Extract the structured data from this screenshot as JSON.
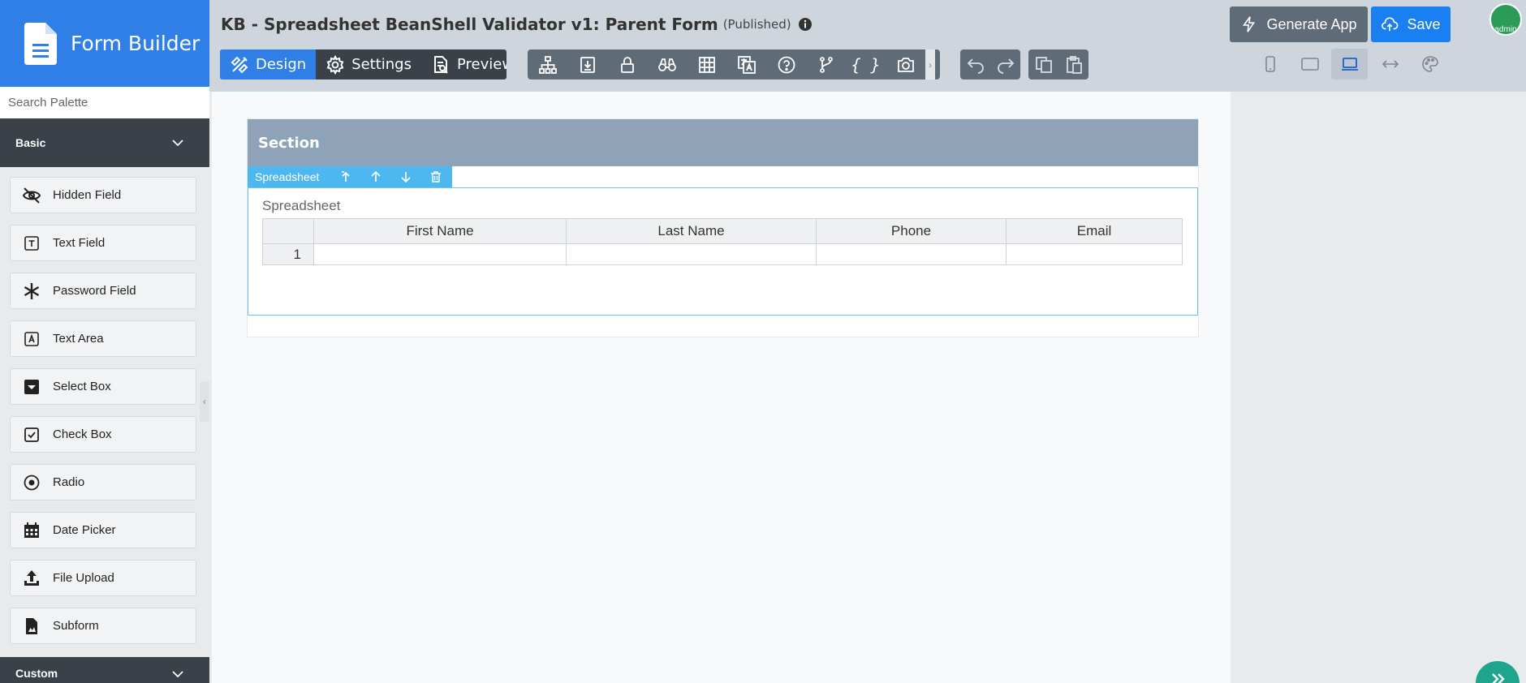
{
  "brand": {
    "title": "Form Builder"
  },
  "header": {
    "title": "KB - Spreadsheet BeanShell Validator v1: Parent Form",
    "status": "(Published)"
  },
  "modes": [
    {
      "label": "Design",
      "icon": "design-icon",
      "active": true
    },
    {
      "label": "Settings",
      "icon": "gear-icon",
      "active": false
    },
    {
      "label": "Preview",
      "icon": "preview-icon",
      "active": false
    }
  ],
  "tools": [
    "tree-icon",
    "import-icon",
    "lock-icon",
    "binoculars-icon",
    "table-icon",
    "translate-icon",
    "help-icon",
    "branch-icon",
    "braces-icon",
    "camera-icon"
  ],
  "history_tools": [
    "undo-icon",
    "redo-icon"
  ],
  "clipboard_tools": [
    "copy-icon",
    "paste-icon"
  ],
  "actions": {
    "generate": "Generate App",
    "save": "Save"
  },
  "avatar": {
    "label": "admin"
  },
  "view_modes": [
    "mobile-icon",
    "tablet-icon",
    "laptop-icon",
    "fit-width-icon",
    "palette-icon"
  ],
  "sidebar": {
    "search_placeholder": "Search Palette",
    "category": "Basic",
    "category2": "Custom",
    "items": [
      {
        "label": "Hidden Field",
        "icon": "eye-slash-icon"
      },
      {
        "label": "Text Field",
        "icon": "text-field-icon"
      },
      {
        "label": "Password Field",
        "icon": "asterisk-icon"
      },
      {
        "label": "Text Area",
        "icon": "text-area-icon"
      },
      {
        "label": "Select Box",
        "icon": "select-box-icon"
      },
      {
        "label": "Check Box",
        "icon": "check-box-icon"
      },
      {
        "label": "Radio",
        "icon": "radio-icon"
      },
      {
        "label": "Date Picker",
        "icon": "calendar-icon"
      },
      {
        "label": "File Upload",
        "icon": "upload-icon"
      },
      {
        "label": "Subform",
        "icon": "subform-icon"
      }
    ]
  },
  "canvas": {
    "section_title": "Section",
    "element_toolbar_label": "Spreadsheet",
    "spreadsheet_label": "Spreadsheet",
    "columns": [
      "First Name",
      "Last Name",
      "Phone",
      "Email"
    ],
    "rows": [
      [
        "1",
        "",
        "",
        "",
        ""
      ]
    ]
  },
  "colors": {
    "brand": "#2f7fe6",
    "save": "#1a7ff0",
    "section": "#8ea3b8",
    "selection": "#4db7f0",
    "sidebar": "#3a4149"
  }
}
